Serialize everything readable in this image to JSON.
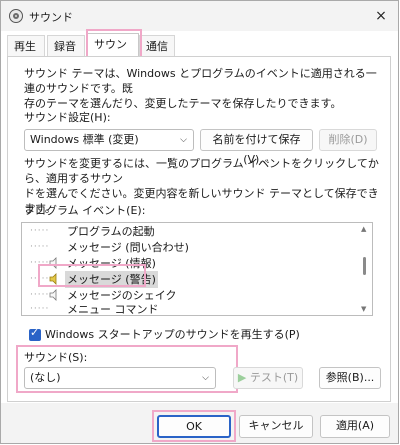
{
  "window": {
    "title": "サウンド",
    "close_icon": "×"
  },
  "tabs": [
    {
      "label": "再生"
    },
    {
      "label": "録音"
    },
    {
      "label": "サウンド"
    },
    {
      "label": "通信"
    }
  ],
  "theme": {
    "description": "サウンド テーマは、Windows とプログラムのイベントに適用される一連のサウンドです。既\n存のテーマを選んだり、変更したテーマを保存したりできます。",
    "label": "サウンド設定(H):",
    "value": "Windows 標準 (変更)",
    "save_button": "名前を付けて保存(V)...",
    "delete_button": "削除(D)"
  },
  "instructions": "サウンドを変更するには、一覧のプログラム イベントをクリックしてから、適用するサウン\nドを選んでください。変更内容を新しいサウンド テーマとして保存できます。",
  "events": {
    "label": "プログラム イベント(E):",
    "items": [
      {
        "label": "プログラムの起動",
        "has_sound": false,
        "selected": false
      },
      {
        "label": "メッセージ (問い合わせ)",
        "has_sound": false,
        "selected": false
      },
      {
        "label": "メッセージ (情報)",
        "has_sound": true,
        "selected": false
      },
      {
        "label": "メッセージ (警告)",
        "has_sound": true,
        "selected": true
      },
      {
        "label": "メッセージのシェイク",
        "has_sound": true,
        "selected": false
      },
      {
        "label": "メニュー コマンド",
        "has_sound": false,
        "selected": false
      }
    ]
  },
  "startup": {
    "label": "Windows スタートアップのサウンドを再生する(P)",
    "checked": true
  },
  "sound": {
    "label": "サウンド(S):",
    "value": "(なし)",
    "test_button": "テスト(T)",
    "browse_button": "参照(B)..."
  },
  "footer": {
    "ok": "OK",
    "cancel": "キャンセル",
    "apply": "適用(A)"
  },
  "colors": {
    "accent": "#2a63c7",
    "highlight": "#f0a8c8",
    "speaker": "#e3c84a"
  }
}
